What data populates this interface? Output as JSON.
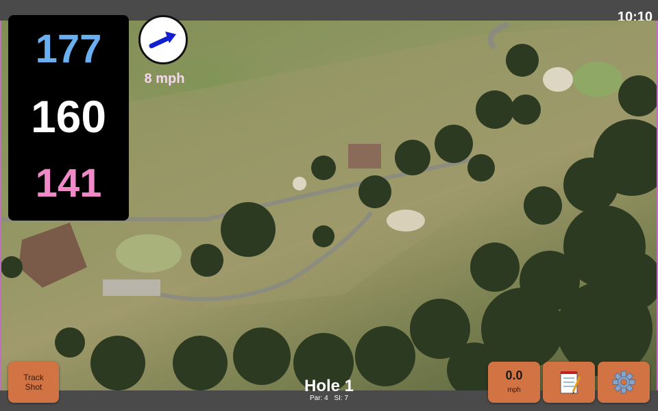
{
  "status": {
    "time": "10:10"
  },
  "distances": {
    "back": "177",
    "middle": "160",
    "front": "141"
  },
  "wind": {
    "speed": "8 mph",
    "arrow_icon": "arrow-icon"
  },
  "hole": {
    "title": "Hole 1",
    "par": "Par: 4",
    "stroke_index": "SI: 7"
  },
  "buttons": {
    "track_shot_line1": "Track",
    "track_shot_line2": "Shot",
    "speed_value": "0.0",
    "speed_unit": "mph",
    "notes_icon": "notepad-icon",
    "settings_icon": "gear-icon"
  },
  "colors": {
    "back": "#6ab0f0",
    "middle": "#ffffff",
    "front": "#f089c8",
    "button": "#d27343"
  }
}
